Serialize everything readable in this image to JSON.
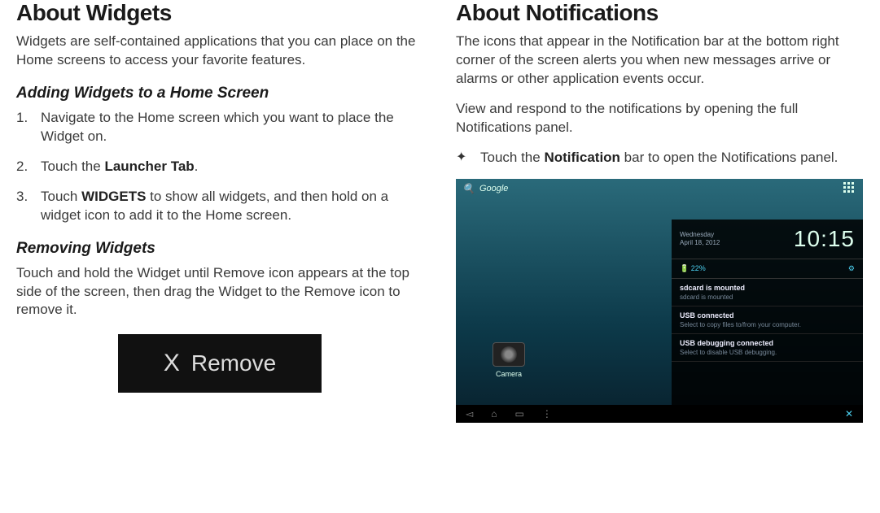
{
  "left": {
    "heading": "About Widgets",
    "intro": "Widgets are self-contained applications that you can place on the Home screens to access your favorite features.",
    "sub1": "Adding Widgets to a Home Screen",
    "step1": "Navigate to the Home screen which you want to place the Widget on.",
    "step2_pre": "Touch the ",
    "step2_bold": "Launcher Tab",
    "step2_post": ".",
    "step3_pre": "Touch ",
    "step3_bold": "WIDGETS",
    "step3_post": " to show all widgets, and then hold on a widget icon to add it to the Home screen.",
    "sub2": "Removing Widgets",
    "remove_para": "Touch and hold the Widget until Remove icon appears at the top side of the screen, then drag the Widget to the Remove icon to remove it.",
    "remove_x": "X",
    "remove_label": "Remove"
  },
  "right": {
    "heading": "About Notifications",
    "p1": "The icons that appear in the Notification bar at the bottom right corner of the screen alerts you when new messages arrive or alarms or other application events occur.",
    "p2": "View and respond to the notifications by opening the full Notifications panel.",
    "bullet_pre": "Touch the ",
    "bullet_bold": "Notification",
    "bullet_post": " bar to open the Notifications panel.",
    "tablet": {
      "search_label": "Google",
      "camera_label": "Camera",
      "date_day": "Wednesday",
      "date_full": "April 18, 2012",
      "time": "10:15",
      "battery": "22%",
      "notif1_title": "sdcard is mounted",
      "notif1_desc": "sdcard is mounted",
      "notif2_title": "USB connected",
      "notif2_desc": "Select to copy files to/from your computer.",
      "notif3_title": "USB debugging connected",
      "notif3_desc": "Select to disable USB debugging."
    }
  }
}
